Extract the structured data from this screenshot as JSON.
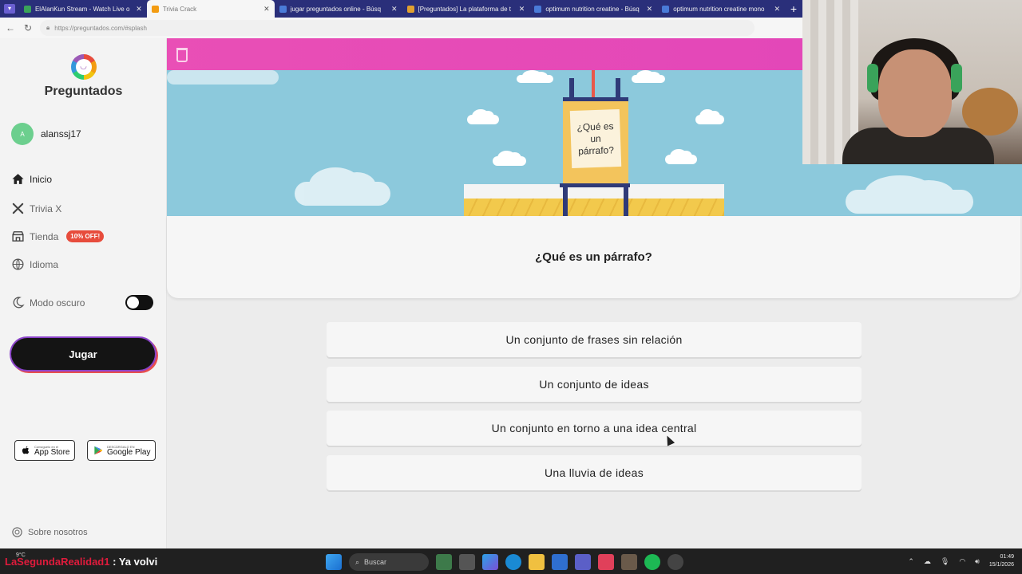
{
  "browser": {
    "tabs": [
      {
        "title": "ElAlanKun Stream - Watch Live o",
        "fav_color": "#3aa35a",
        "active": false
      },
      {
        "title": "Trivia Crack",
        "fav_color": "#f39c12",
        "active": true
      },
      {
        "title": "jugar preguntados online - Búsq",
        "fav_color": "#4a7bd8",
        "active": false
      },
      {
        "title": "[Preguntados] La plataforma de t",
        "fav_color": "#e0a030",
        "active": false
      },
      {
        "title": "optimum nutrition creatine - Búsq",
        "fav_color": "#4a7bd8",
        "active": false
      },
      {
        "title": "optimum nutrition creatine mono",
        "fav_color": "#4a7bd8",
        "active": false
      }
    ],
    "url": "https://preguntados.com/#splash"
  },
  "sidebar": {
    "brand": "Preguntados",
    "user": {
      "initial": "A",
      "name": "alanssj17"
    },
    "nav": [
      {
        "label": "Inicio",
        "icon": "home-icon"
      },
      {
        "label": "Trivia X",
        "icon": "trivia-x-icon"
      },
      {
        "label": "Tienda",
        "icon": "store-icon",
        "badge": "10% OFF!"
      },
      {
        "label": "Idioma",
        "icon": "globe-icon"
      }
    ],
    "dark_mode_label": "Modo oscuro",
    "play_label": "Jugar",
    "app_store": {
      "small": "Consíguelo en el",
      "big": "App Store"
    },
    "google_play": {
      "small": "DESCÁRGALO EN",
      "big": "Google Play"
    },
    "about_label": "Sobre nosotros"
  },
  "game": {
    "board_text": "¿Qué es un párrafo?",
    "question": "¿Qué es un párrafo?",
    "answers": [
      "Un conjunto de frases sin relación",
      "Un conjunto de ideas",
      "Un conjunto en torno a una idea central",
      "Una lluvia de ideas"
    ],
    "accent_color": "#e94fb6"
  },
  "overlay": {
    "chat_user": "LaSegundaRealidad1",
    "chat_message": ": Ya volvi"
  },
  "taskbar": {
    "weather": "9°C",
    "search_label": "Buscar",
    "time": "01:49",
    "date": "15/1/2026"
  }
}
